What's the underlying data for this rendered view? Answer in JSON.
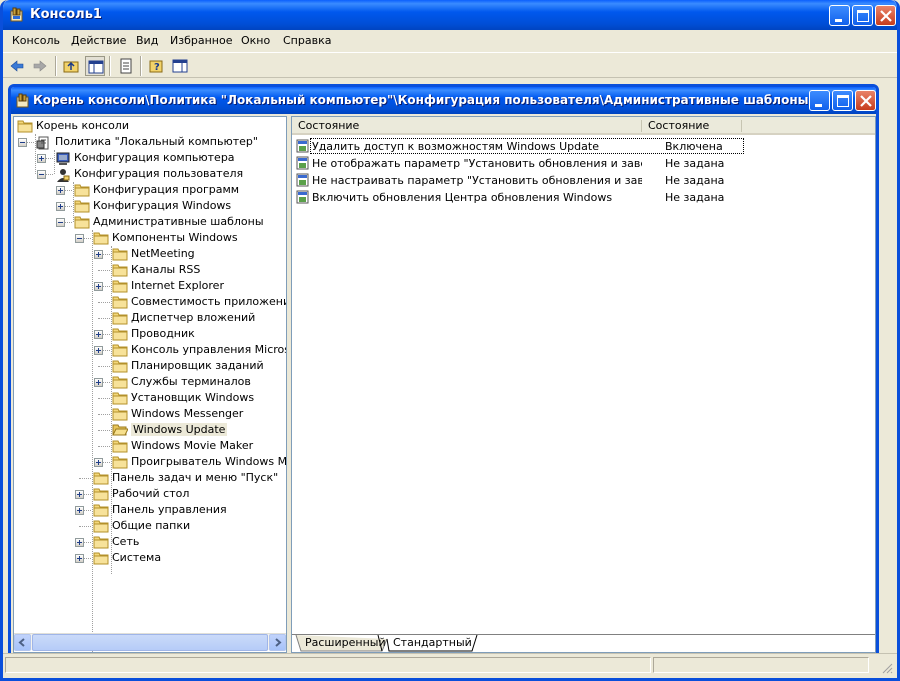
{
  "window": {
    "title": "Консоль1",
    "accent": "#0054e3",
    "close_color": "#d9532f"
  },
  "menu": [
    "Консоль",
    "Действие",
    "Вид",
    "Избранное",
    "Окно",
    "Справка"
  ],
  "toolbar": {
    "buttons": [
      "back-arrow-icon",
      "forward-arrow-icon",
      "up-folder-icon",
      "show-hide-tree-icon",
      "export-list-icon",
      "help-icon",
      "show-hide-action-pane-icon"
    ]
  },
  "child_window": {
    "title": "Корень консоли\\Политика \"Локальный компьютер\"\\Конфигурация пользователя\\Административные шаблоны \\Компо..."
  },
  "tree": {
    "nodes": [
      {
        "label": "Корень консоли",
        "level": 0,
        "expander": "none",
        "icon": "folder-icon"
      },
      {
        "label": "Политика \"Локальный компьютер\"",
        "level": 1,
        "expander": "minus",
        "icon": "policy-icon"
      },
      {
        "label": "Конфигурация компьютера",
        "level": 2,
        "expander": "plus",
        "icon": "computer-icon"
      },
      {
        "label": "Конфигурация пользователя",
        "level": 2,
        "expander": "minus",
        "icon": "user-icon"
      },
      {
        "label": "Конфигурация программ",
        "level": 3,
        "expander": "plus",
        "icon": "folder-icon"
      },
      {
        "label": "Конфигурация Windows",
        "level": 3,
        "expander": "plus",
        "icon": "folder-icon"
      },
      {
        "label": "Административные шаблоны",
        "level": 3,
        "expander": "minus",
        "icon": "folder-icon"
      },
      {
        "label": "Компоненты Windows",
        "level": 4,
        "expander": "minus",
        "icon": "folder-icon"
      },
      {
        "label": "NetMeeting",
        "level": 5,
        "expander": "plus",
        "icon": "folder-icon"
      },
      {
        "label": "Каналы RSS",
        "level": 5,
        "expander": "none",
        "icon": "folder-icon"
      },
      {
        "label": "Internet Explorer",
        "level": 5,
        "expander": "plus",
        "icon": "folder-icon"
      },
      {
        "label": "Совместимость приложений",
        "level": 5,
        "expander": "none",
        "icon": "folder-icon"
      },
      {
        "label": "Диспетчер вложений",
        "level": 5,
        "expander": "none",
        "icon": "folder-icon"
      },
      {
        "label": "Проводник",
        "level": 5,
        "expander": "plus",
        "icon": "folder-icon"
      },
      {
        "label": "Консоль управления Microsof",
        "level": 5,
        "expander": "plus",
        "icon": "folder-icon"
      },
      {
        "label": "Планировщик заданий",
        "level": 5,
        "expander": "none",
        "icon": "folder-icon"
      },
      {
        "label": "Службы терминалов",
        "level": 5,
        "expander": "plus",
        "icon": "folder-icon"
      },
      {
        "label": "Установщик Windows",
        "level": 5,
        "expander": "none",
        "icon": "folder-icon"
      },
      {
        "label": "Windows Messenger",
        "level": 5,
        "expander": "none",
        "icon": "folder-icon"
      },
      {
        "label": "Windows Update",
        "level": 5,
        "expander": "none",
        "icon": "open-folder-icon",
        "selected": true
      },
      {
        "label": "Windows Movie Maker",
        "level": 5,
        "expander": "none",
        "icon": "folder-icon"
      },
      {
        "label": "Проигрыватель Windows Mec",
        "level": 5,
        "expander": "plus",
        "icon": "folder-icon"
      },
      {
        "label": "Панель задач и меню \"Пуск\"",
        "level": 4,
        "expander": "none",
        "icon": "folder-icon"
      },
      {
        "label": "Рабочий стол",
        "level": 4,
        "expander": "plus",
        "icon": "folder-icon"
      },
      {
        "label": "Панель управления",
        "level": 4,
        "expander": "plus",
        "icon": "folder-icon"
      },
      {
        "label": "Общие папки",
        "level": 4,
        "expander": "none",
        "icon": "folder-icon"
      },
      {
        "label": "Сеть",
        "level": 4,
        "expander": "plus",
        "icon": "folder-icon"
      },
      {
        "label": "Система",
        "level": 4,
        "expander": "plus",
        "icon": "folder-icon"
      }
    ]
  },
  "list": {
    "columns": [
      "Состояние",
      "Состояние"
    ],
    "rows": [
      {
        "name": "Удалить доступ к возможностям Windows Update",
        "state": "Включена",
        "focused": true
      },
      {
        "name": "Не отображать параметр \"Установить обновления и заверши...",
        "state": "Не задана"
      },
      {
        "name": "Не настраивать параметр \"Установить обновления и заверш...",
        "state": "Не задана"
      },
      {
        "name": "Включить обновления Центра обновления Windows",
        "state": "Не задана"
      }
    ]
  },
  "tabs": {
    "items": [
      "Расширенный",
      "Стандартный"
    ],
    "active": "Стандартный"
  }
}
